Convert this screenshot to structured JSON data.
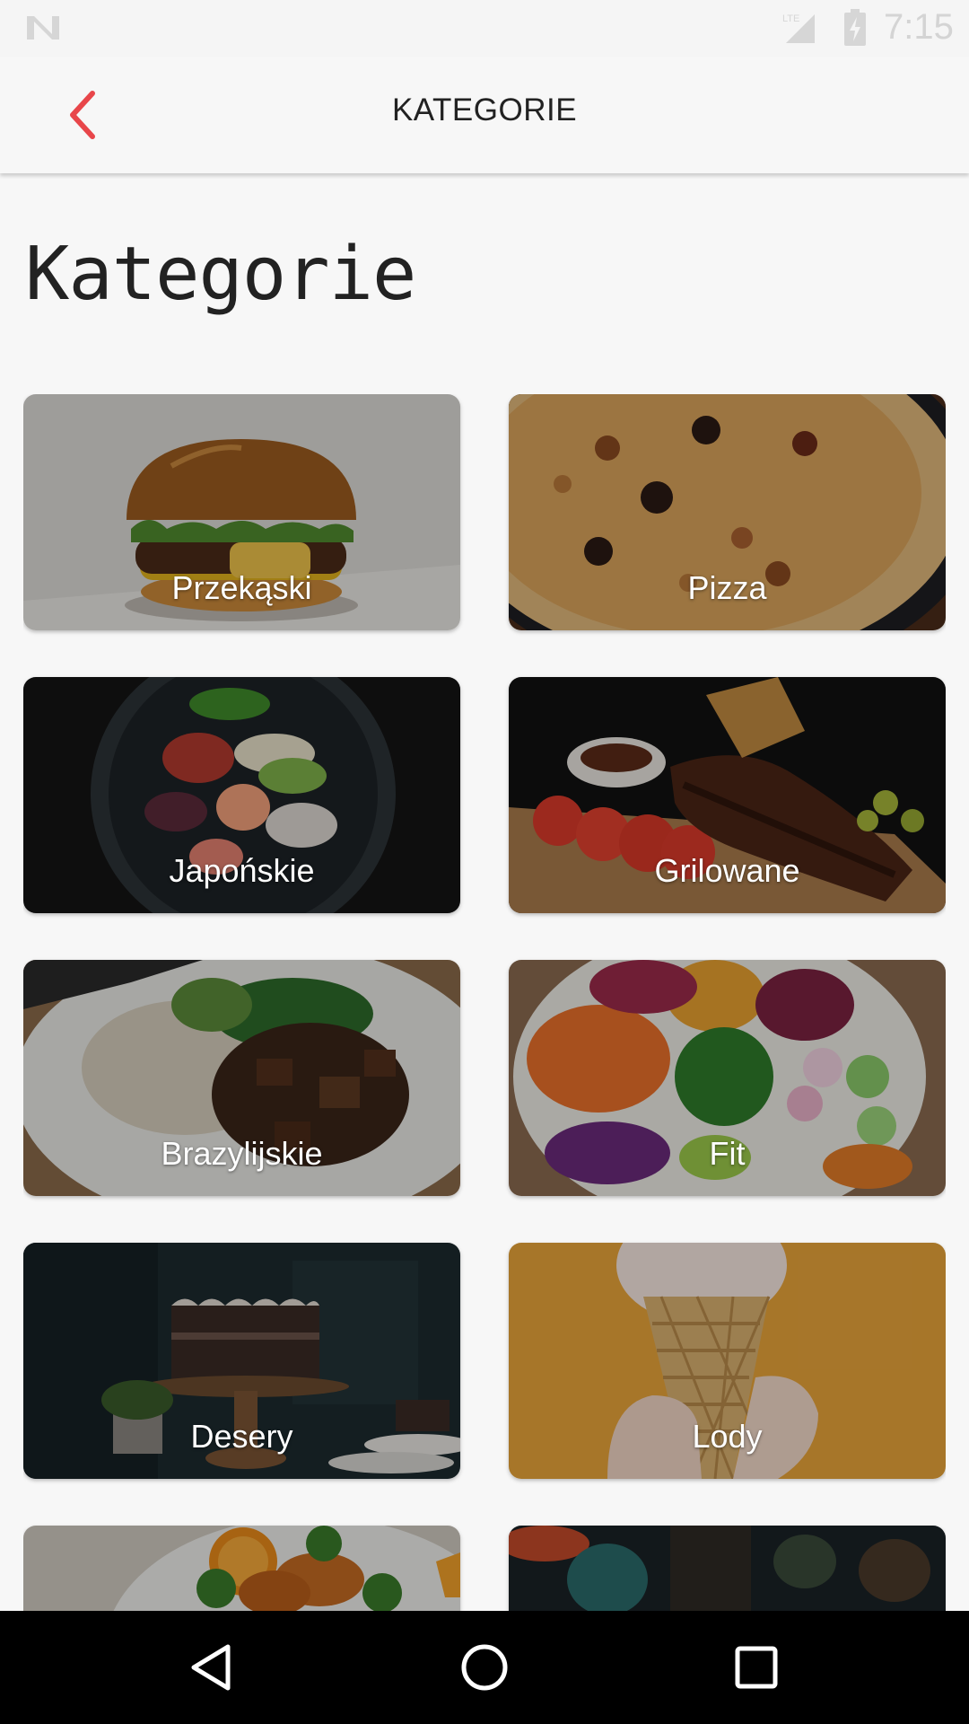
{
  "status_bar": {
    "time": "7:15",
    "network": "LTE",
    "icons": [
      "notification-n-icon",
      "signal-icon",
      "battery-charging-icon"
    ]
  },
  "app_bar": {
    "title": "KATEGORIE",
    "back_icon": "chevron-left-icon",
    "accent_color": "#e8464a"
  },
  "page": {
    "title": "Kategorie"
  },
  "categories": [
    {
      "label": "Przekąski",
      "image": "burger"
    },
    {
      "label": "Pizza",
      "image": "pizza"
    },
    {
      "label": "Japońskie",
      "image": "sushi-bowl"
    },
    {
      "label": "Grilowane",
      "image": "grilled-ribs"
    },
    {
      "label": "Brazylijskie",
      "image": "rice-and-meat"
    },
    {
      "label": "Fit",
      "image": "salad"
    },
    {
      "label": "Desery",
      "image": "chocolate-cake"
    },
    {
      "label": "Lody",
      "image": "ice-cream-cone"
    },
    {
      "label": "",
      "image": "chicken-broccoli"
    },
    {
      "label": "",
      "image": "restaurant-interior"
    }
  ],
  "nav_bar": {
    "buttons": [
      "back-triangle-icon",
      "home-circle-icon",
      "recents-square-icon"
    ]
  }
}
